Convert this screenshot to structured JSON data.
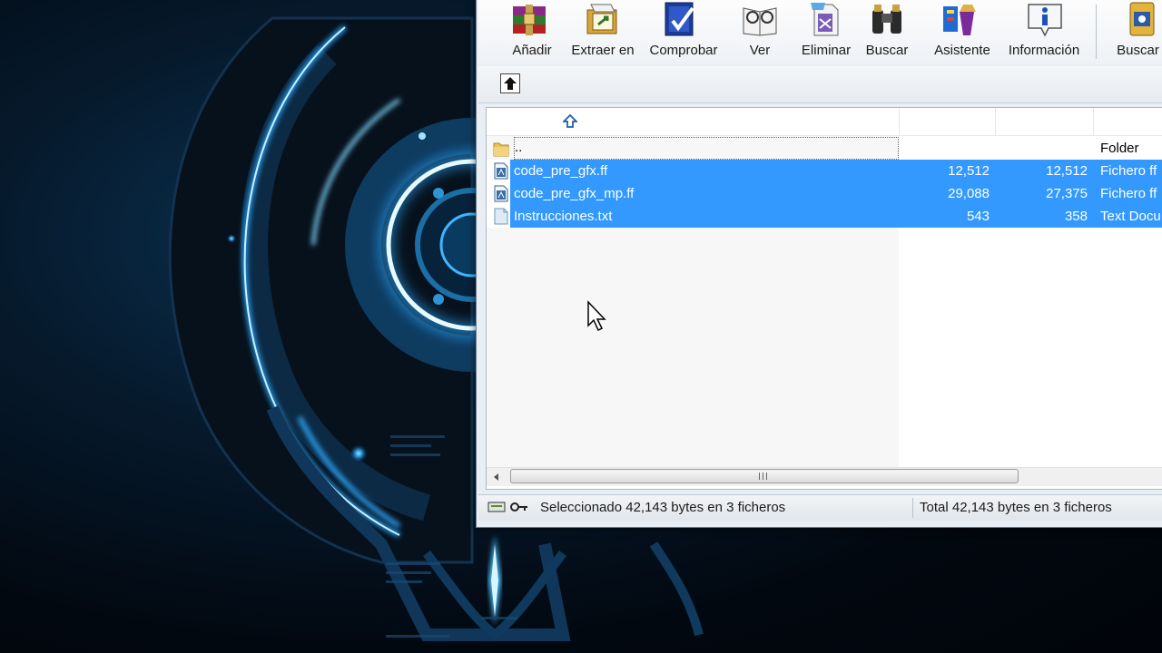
{
  "toolbar": {
    "buttons": [
      {
        "label": "Añadir",
        "icon": "add-archive-icon"
      },
      {
        "label": "Extraer en",
        "icon": "extract-icon"
      },
      {
        "label": "Comprobar",
        "icon": "test-icon"
      },
      {
        "label": "Ver",
        "icon": "view-icon"
      },
      {
        "label": "Eliminar",
        "icon": "delete-icon"
      },
      {
        "label": "Buscar",
        "icon": "binoculars-icon"
      },
      {
        "label": "Asistente",
        "icon": "wizard-icon"
      },
      {
        "label": "Información",
        "icon": "info-icon"
      },
      {
        "label": "Buscar vi",
        "icon": "virus-scan-icon"
      }
    ]
  },
  "address": {
    "up_icon": "up-folder-icon"
  },
  "filelist": {
    "sort_icon": "sort-ascending-icon",
    "parent": {
      "name": "..",
      "type": "Folder"
    },
    "files": [
      {
        "name": "code_pre_gfx.ff",
        "size": "12,512",
        "packed": "12,512",
        "type": "Fichero ff",
        "icon": "document-icon",
        "selected": true
      },
      {
        "name": "code_pre_gfx_mp.ff",
        "size": "29,088",
        "packed": "27,375",
        "type": "Fichero ff",
        "icon": "document-icon",
        "selected": true
      },
      {
        "name": "Instrucciones.txt",
        "size": "543",
        "packed": "358",
        "type": "Text Docu",
        "icon": "text-file-icon",
        "selected": true
      }
    ]
  },
  "status": {
    "selected": "Seleccionado 42,143 bytes en 3 ficheros",
    "total": "Total 42,143 bytes en 3 ficheros"
  },
  "colors": {
    "selection": "#3399ff",
    "accent_glow": "#2aa8ff"
  }
}
